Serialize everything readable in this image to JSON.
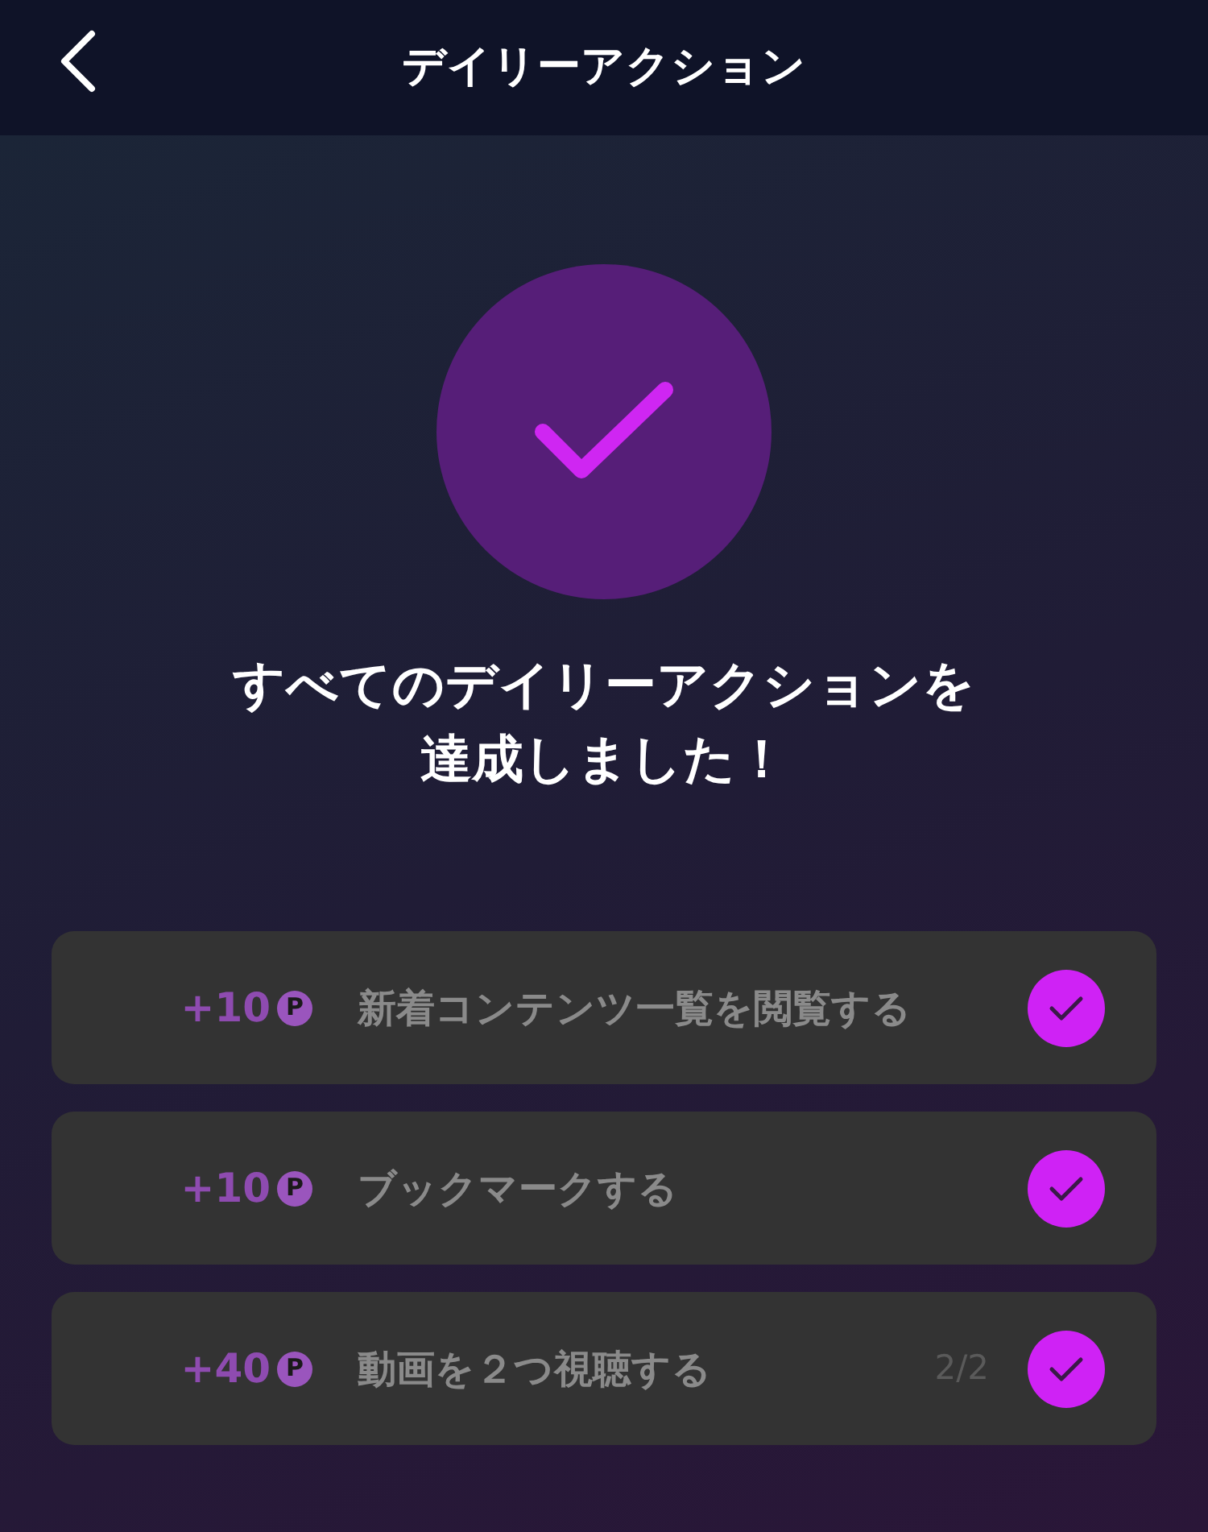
{
  "header": {
    "title": "デイリーアクション"
  },
  "status": {
    "completed": true,
    "message_lines": [
      "すべてのデイリーアクションを",
      "達成しました！"
    ]
  },
  "actions": [
    {
      "points": "+10",
      "unit": "P",
      "label": "新着コンテンツ一覧を閲覧する",
      "completed": true
    },
    {
      "points": "+10",
      "unit": "P",
      "label": "ブックマークする",
      "completed": true
    },
    {
      "points": "+40",
      "unit": "P",
      "label": "動画を２つ視聴する",
      "progress": "2/2",
      "completed": true
    }
  ]
}
